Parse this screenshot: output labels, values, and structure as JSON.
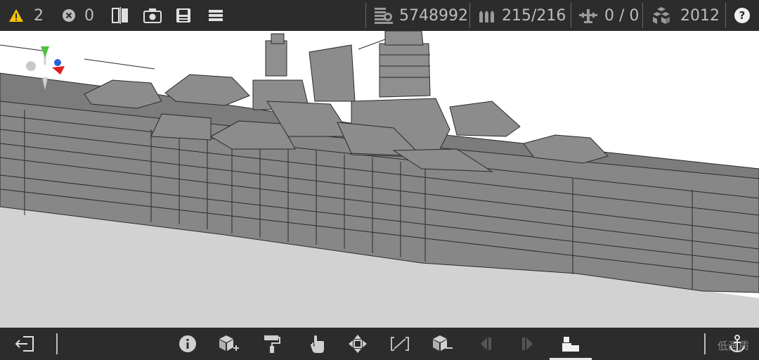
{
  "toolbar": {
    "warnings_count": "2",
    "errors_count": "0",
    "displacement": "5748992",
    "ammo": "215/216",
    "aircraft": "0 / 0",
    "year": "2012",
    "help_label": "?"
  },
  "bottom": {
    "quality_label": "低画质"
  },
  "colors": {
    "bar_bg": "#2c2c2c",
    "icon": "#d0d0d0",
    "warning": "#f5c400",
    "hull": "#8a8a8a"
  }
}
